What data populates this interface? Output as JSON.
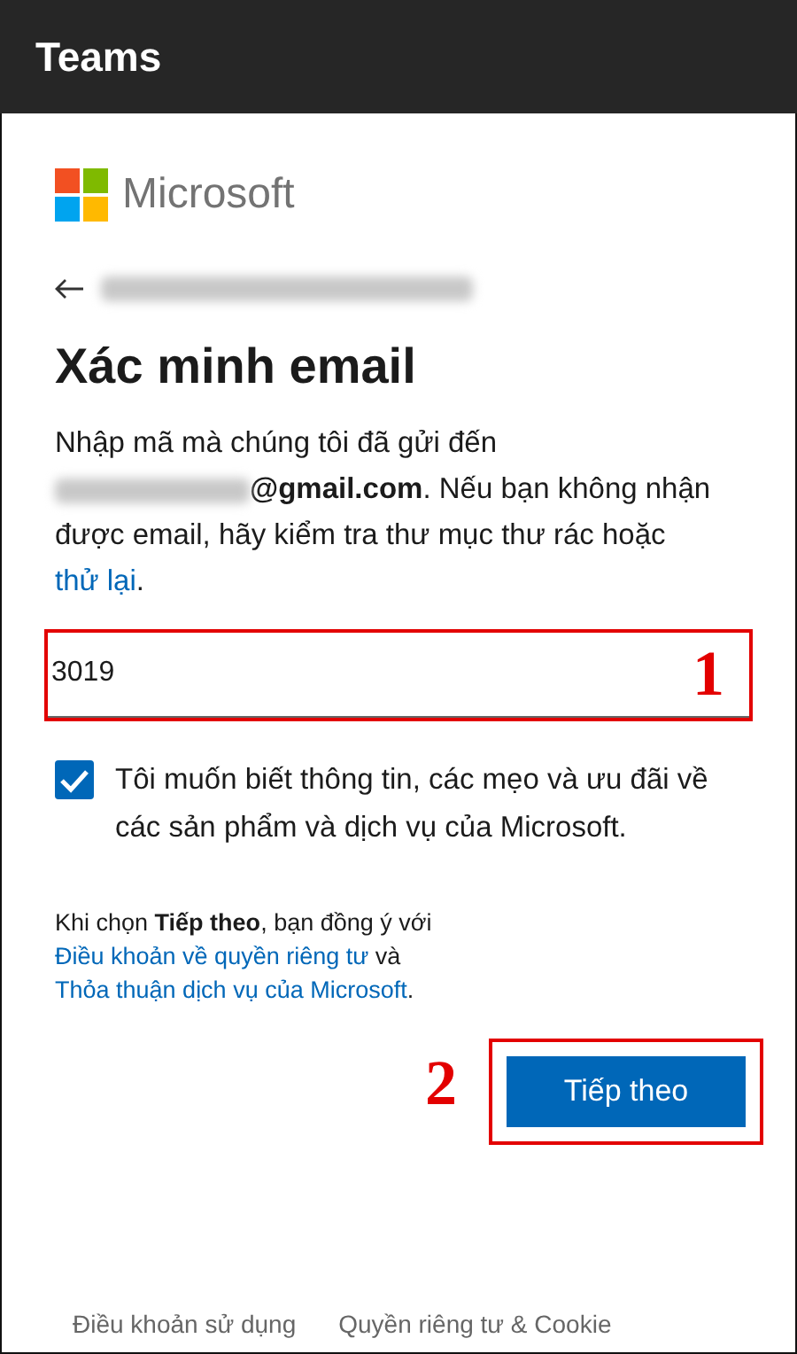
{
  "app_bar": {
    "title": "Teams"
  },
  "brand": {
    "name": "Microsoft"
  },
  "identity": {
    "email_blurred": true
  },
  "heading": "Xác minh email",
  "intro": {
    "before": "Nhập mã mà chúng tôi đã gửi đến",
    "email_suffix": "@gmail.com",
    "after": ". Nếu bạn không nhận được email, hãy kiểm tra thư mục thư rác hoặc ",
    "link": "thử lại",
    "end": "."
  },
  "code_field": {
    "value": "3019"
  },
  "consent": {
    "checked": true,
    "label": "Tôi muốn biết thông tin, các mẹo và ưu đãi về các sản phẩm và dịch vụ của Microsoft."
  },
  "legal": {
    "before": "Khi chọn **Tiếp theo**, bạn đồng ý với ",
    "link_1": "Điều khoản về quyền riêng tư",
    "middle": " và ",
    "link_2": "Thỏa thuận dịch vụ của Microsoft",
    "end": "."
  },
  "next_button": {
    "label": "Tiếp theo"
  },
  "annotations": [
    {
      "label": "1"
    },
    {
      "label": "2"
    }
  ],
  "footer": {
    "links": [
      "Điều khoản sử dụng",
      "Quyền riêng tư & Cookie"
    ]
  }
}
